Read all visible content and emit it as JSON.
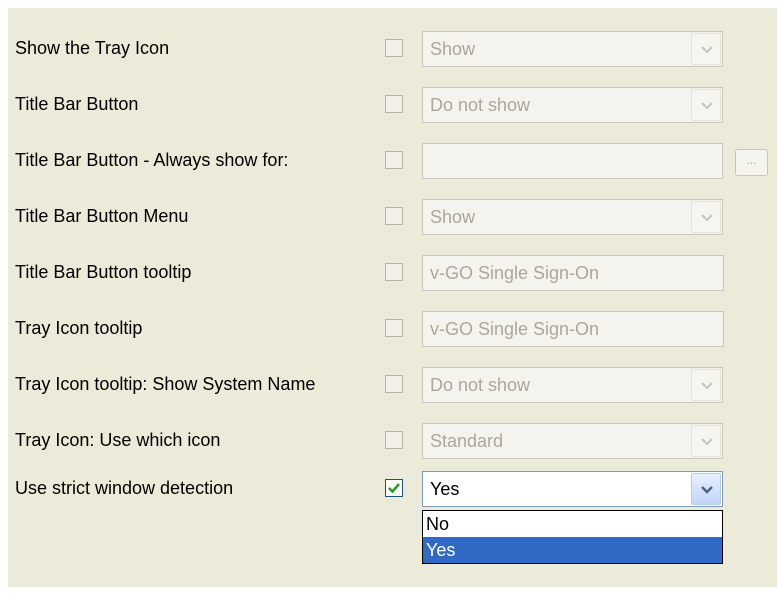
{
  "settings": [
    {
      "label": "Show the Tray Icon",
      "checked": false,
      "control": "select",
      "value": "Show",
      "enabled": false
    },
    {
      "label": "Title Bar Button",
      "checked": false,
      "control": "select",
      "value": "Do not show",
      "enabled": false
    },
    {
      "label": "Title Bar Button - Always show for:",
      "checked": false,
      "control": "text-ellipsis",
      "value": "",
      "button_label": "...",
      "enabled": false
    },
    {
      "label": "Title Bar Button Menu",
      "checked": false,
      "control": "select",
      "value": "Show",
      "enabled": false
    },
    {
      "label": "Title Bar Button tooltip",
      "checked": false,
      "control": "text",
      "value": "v-GO Single Sign-On",
      "enabled": false
    },
    {
      "label": "Tray Icon tooltip",
      "checked": false,
      "control": "text",
      "value": "v-GO Single Sign-On",
      "enabled": false
    },
    {
      "label": "Tray Icon tooltip: Show System Name",
      "checked": false,
      "control": "select",
      "value": "Do not show",
      "enabled": false
    },
    {
      "label": "Tray Icon: Use which icon",
      "checked": false,
      "control": "select",
      "value": "Standard",
      "enabled": false
    },
    {
      "label": "Use strict window detection",
      "checked": true,
      "control": "select",
      "value": "Yes",
      "enabled": true
    }
  ],
  "open_dropdown": {
    "options": [
      "No",
      "Yes"
    ],
    "selected": "Yes"
  },
  "colors": {
    "panel_bg": "#ecead8",
    "disabled_text": "#aca899",
    "selection_bg": "#316ac5",
    "checkmark": "#21a121"
  }
}
